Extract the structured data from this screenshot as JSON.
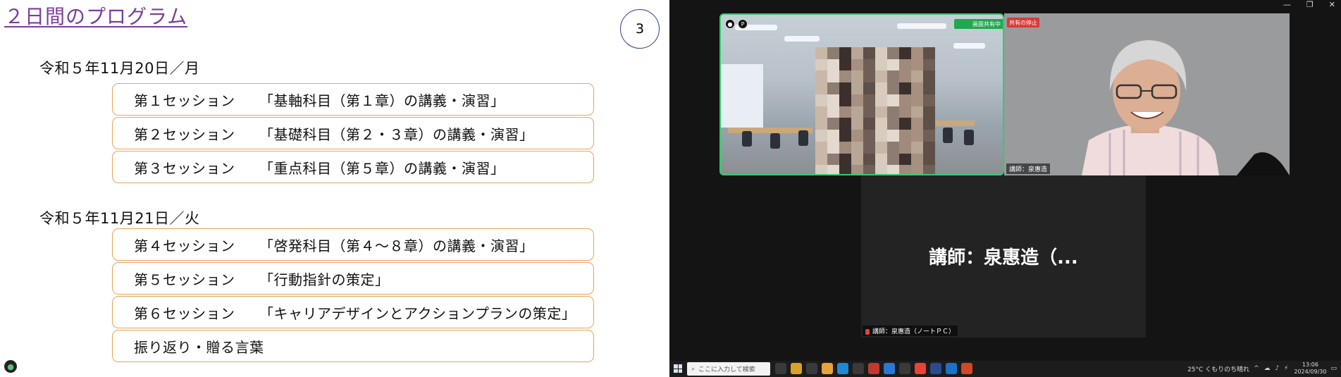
{
  "slide": {
    "title": "２日間のプログラム",
    "page_number": "3",
    "days": [
      {
        "heading": "令和５年11月20日／月",
        "sessions": [
          {
            "label": "第１セッション",
            "title": "「基軸科目（第１章）の講義・演習」"
          },
          {
            "label": "第２セッション",
            "title": "「基礎科目（第２・３章）の講義・演習」"
          },
          {
            "label": "第３セッション",
            "title": "「重点科目（第５章）の講義・演習」"
          }
        ]
      },
      {
        "heading": "令和５年11月21日／火",
        "sessions": [
          {
            "label": "第４セッション",
            "title": "「啓発科目（第４～８章）の講義・演習」"
          },
          {
            "label": "第５セッション",
            "title": "「行動指針の策定」"
          },
          {
            "label": "第６セッション",
            "title": "「キャリアデザインとアクションプランの策定」"
          },
          {
            "label": "",
            "title": "振り返り・贈る言葉"
          }
        ]
      }
    ]
  },
  "conference": {
    "tile1_banner": "画面共有中",
    "tile2_banner": "共有の停止",
    "tile2_name": "講師：泉惠造",
    "tile3_big_name": "講師：泉惠造（...",
    "tile3_name": "講師：泉惠造（ノートＰＣ）",
    "colors": {
      "active_border": "#2ecc71",
      "share_banner": "#1fa84f",
      "stop_banner": "#d63a3a"
    }
  },
  "taskbar": {
    "search_placeholder": "ここに入力して検索",
    "weather": "25°C くもりのち晴れ",
    "time": "13:06",
    "date": "2024/09/30",
    "app_colors": [
      "#3a3a3a",
      "#d9a227",
      "#3a3a3a",
      "#e8a33b",
      "#1e8ad6",
      "#3a3a3a",
      "#c03a2b",
      "#2a78d4",
      "#3a3a3a",
      "#ea4335",
      "#2a4c8a",
      "#1a73c8",
      "#d24726"
    ]
  }
}
